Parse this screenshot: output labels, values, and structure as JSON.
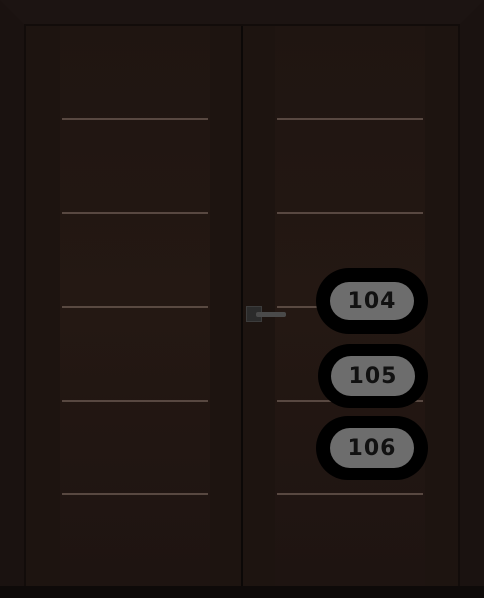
{
  "labels": {
    "first": "104",
    "second": "105",
    "third": "106"
  },
  "colors": {
    "door": "#1f1511",
    "groove": "#6b5a52",
    "badge_outer": "#000000",
    "badge_inner": "#6d6d6d"
  }
}
